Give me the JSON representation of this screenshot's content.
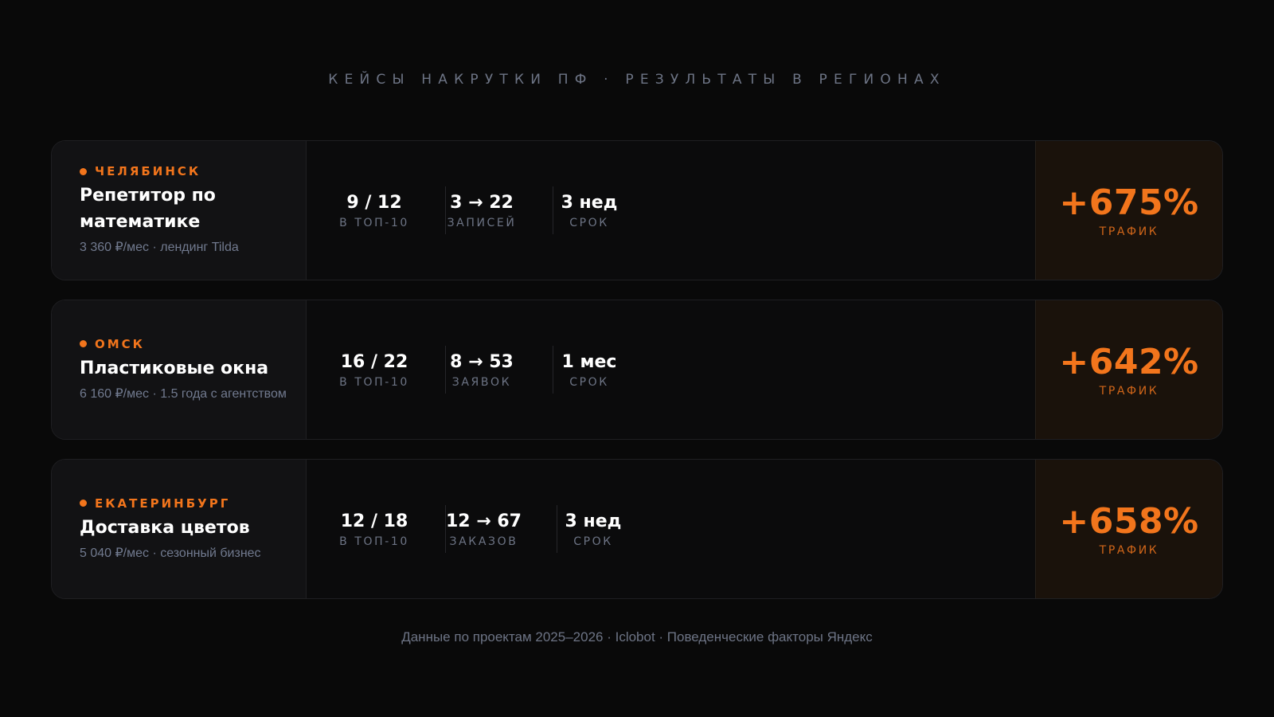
{
  "title": "КЕЙСЫ НАКРУТКИ ПФ · РЕЗУЛЬТАТЫ В РЕГИОНАХ",
  "colors": {
    "accent": "#f2751c",
    "background": "#090909",
    "muted_text": "#6d7485"
  },
  "cases": [
    {
      "city": "ЧЕЛЯБИНСК",
      "niche": "Репетитор по математике",
      "desc": "3 360 ₽/мес · лендинг Tilda",
      "metrics": [
        {
          "value": "9 / 12",
          "label": "В ТОП-10"
        },
        {
          "value": "3 → 22",
          "label": "ЗАПИСЕЙ"
        },
        {
          "value": "3 нед",
          "label": "СРОК"
        }
      ],
      "result": {
        "value": "+675%",
        "label": "ТРАФИК"
      }
    },
    {
      "city": "ОМСК",
      "niche": "Пластиковые окна",
      "desc": "6 160 ₽/мес · 1.5 года с агентством",
      "metrics": [
        {
          "value": "16 / 22",
          "label": "В ТОП-10"
        },
        {
          "value": "8 → 53",
          "label": "ЗАЯВОК"
        },
        {
          "value": "1 мес",
          "label": "СРОК"
        }
      ],
      "result": {
        "value": "+642%",
        "label": "ТРАФИК"
      }
    },
    {
      "city": "ЕКАТЕРИНБУРГ",
      "niche": "Доставка цветов",
      "desc": "5 040 ₽/мес · сезонный бизнес",
      "metrics": [
        {
          "value": "12 / 18",
          "label": "В ТОП-10"
        },
        {
          "value": "12 → 67",
          "label": "ЗАКАЗОВ"
        },
        {
          "value": "3 нед",
          "label": "СРОК"
        }
      ],
      "result": {
        "value": "+658%",
        "label": "ТРАФИК"
      }
    }
  ],
  "footer": "Данные по проектам 2025–2026 · Iclobot · Поведенческие факторы Яндекс"
}
